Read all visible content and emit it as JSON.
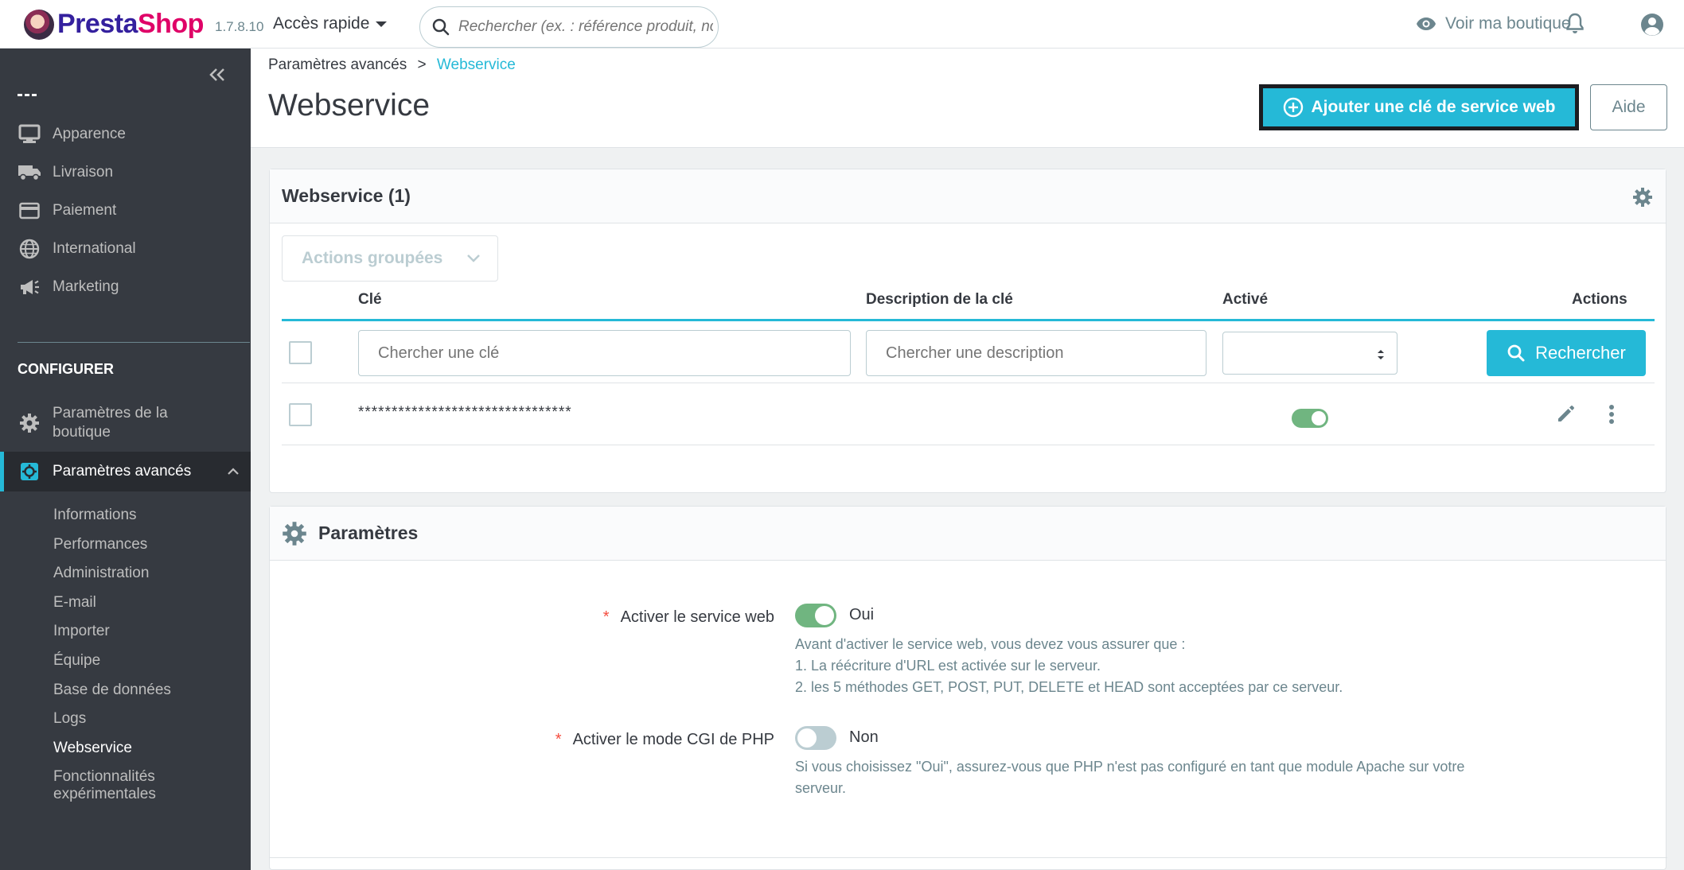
{
  "header": {
    "logo_presta": "Presta",
    "logo_shop": "Shop",
    "version": "1.7.8.10",
    "quick_access": "Accès rapide",
    "search_placeholder": "Rechercher (ex. : référence produit, nom",
    "view_shop": "Voir ma boutique"
  },
  "sidebar": {
    "items": [
      {
        "label": "Apparence",
        "icon": "monitor-icon"
      },
      {
        "label": "Livraison",
        "icon": "truck-icon"
      },
      {
        "label": "Paiement",
        "icon": "credit-card-icon"
      },
      {
        "label": "International",
        "icon": "globe-icon"
      },
      {
        "label": "Marketing",
        "icon": "megaphone-icon"
      }
    ],
    "section_title": "CONFIGURER",
    "shop_params": "Paramètres de la boutique",
    "advanced_params": "Paramètres avancés",
    "sub_items": [
      "Informations",
      "Performances",
      "Administration",
      "E-mail",
      "Importer",
      "Équipe",
      "Base de données",
      "Logs",
      "Webservice",
      "Fonctionnalités expérimentales"
    ]
  },
  "page": {
    "breadcrumb_parent": "Paramètres avancés",
    "breadcrumb_sep": ">",
    "breadcrumb_current": "Webservice",
    "title": "Webservice",
    "add_key_button": "Ajouter une clé de service web",
    "help_button": "Aide"
  },
  "list": {
    "title": "Webservice (1)",
    "bulk_actions": "Actions groupées",
    "columns": {
      "key": "Clé",
      "description": "Description de la clé",
      "active": "Activé",
      "actions": "Actions"
    },
    "filter_key_placeholder": "Chercher une clé",
    "filter_desc_placeholder": "Chercher une description",
    "search_button": "Rechercher",
    "rows": [
      {
        "key": "********************************",
        "active": true
      }
    ]
  },
  "params": {
    "title": "Paramètres",
    "webservice_label": "Activer le service web",
    "webservice_value": "Oui",
    "webservice_help_1": "Avant d'activer le service web, vous devez vous assurer que :",
    "webservice_help_2": "1. La réécriture d'URL est activée sur le serveur.",
    "webservice_help_3": "2. les 5 méthodes GET, POST, PUT, DELETE et HEAD sont acceptées par ce serveur.",
    "cgi_label": "Activer le mode CGI de PHP",
    "cgi_value": "Non",
    "cgi_help_1": "Si vous choisissez \"Oui\", assurez-vous que PHP n'est pas configuré en tant que module Apache sur votre",
    "cgi_help_2": "serveur."
  },
  "colors": {
    "accent": "#25b9d7",
    "sidebar": "#363a41",
    "success": "#70b580"
  }
}
